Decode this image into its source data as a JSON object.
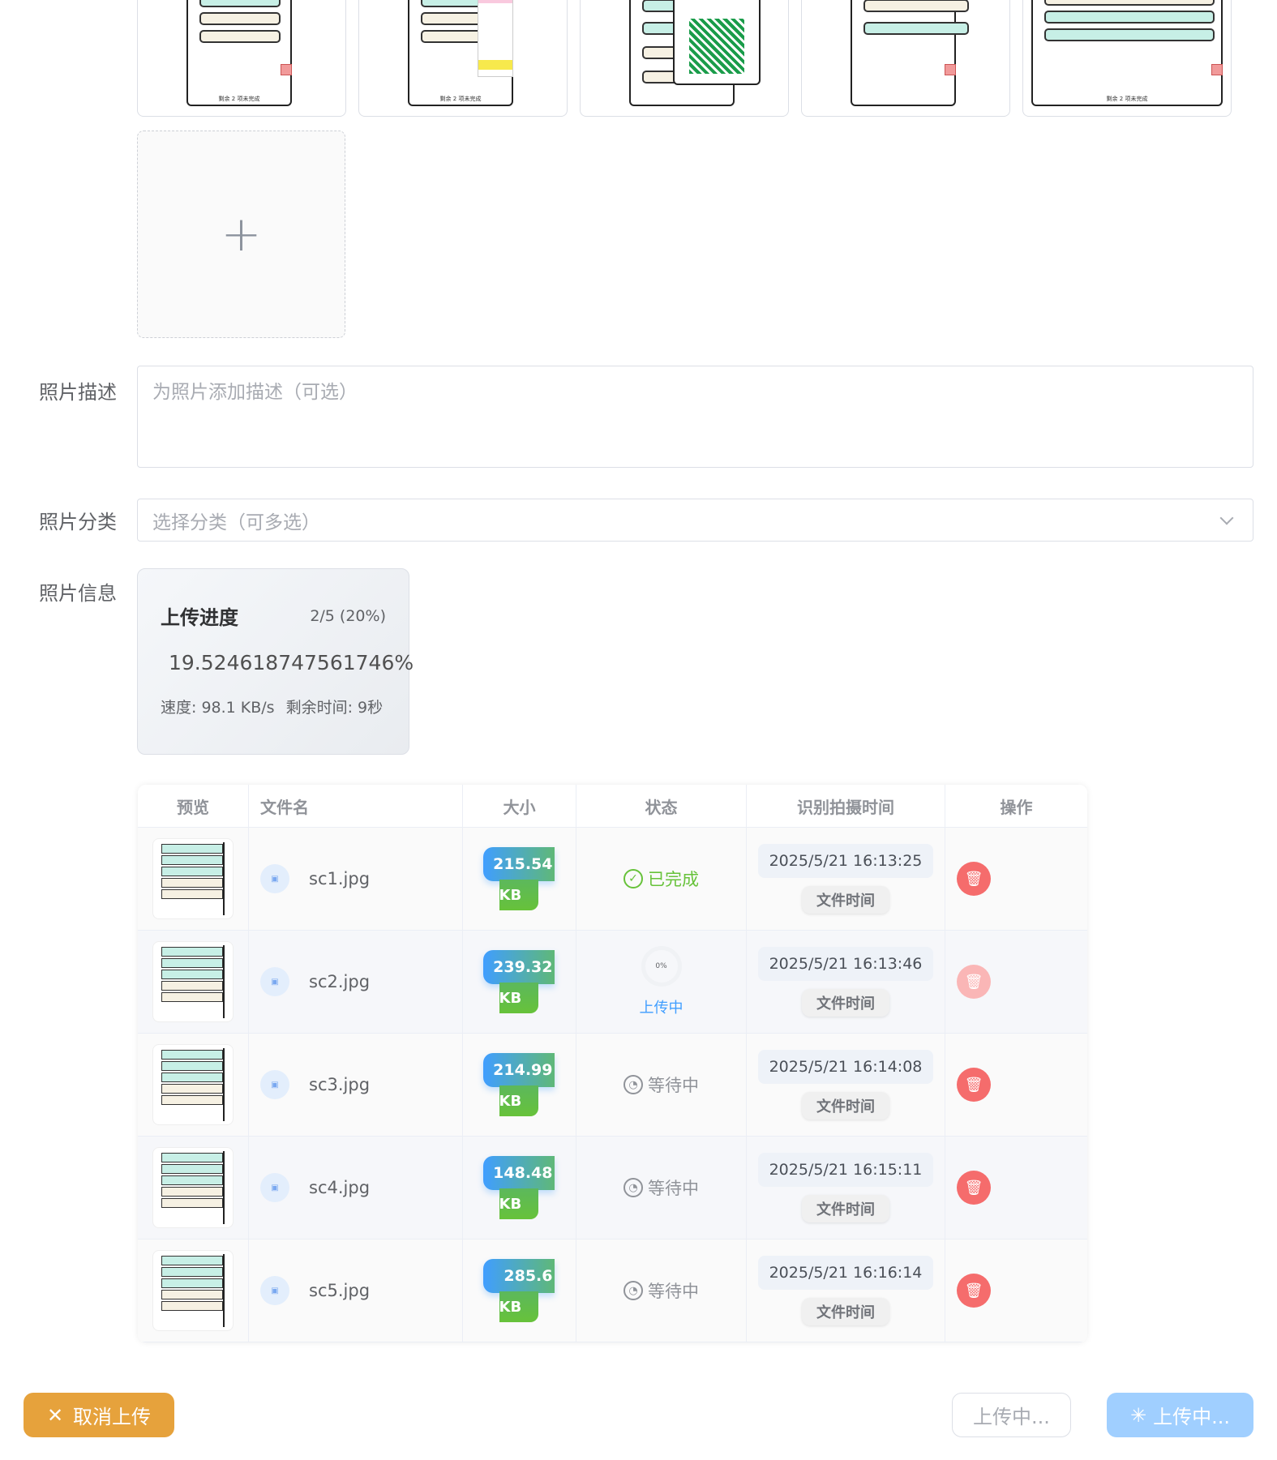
{
  "thumbnails": [
    {
      "caption": "剩余 2 项未完成"
    },
    {
      "caption": "剩余 2 项未完成"
    },
    {
      "caption": ""
    },
    {
      "caption": ""
    },
    {
      "caption": "剩余 2 项未完成"
    }
  ],
  "upload": {
    "add_icon": "+"
  },
  "form": {
    "description_label": "照片描述",
    "description_placeholder": "为照片添加描述（可选）",
    "category_label": "照片分类",
    "category_placeholder": "选择分类（可多选）",
    "info_label": "照片信息"
  },
  "progress": {
    "title": "上传进度",
    "count": "2/5 (20%)",
    "percent_text": "19.524618747561746%",
    "speed": "速度: 98.1 KB/s",
    "remaining": "剩余时间: 9秒",
    "percent": 19.52
  },
  "table": {
    "headers": [
      "预览",
      "文件名",
      "大小",
      "状态",
      "识别拍摄时间",
      "操作"
    ],
    "rows": [
      {
        "name": "sc1.jpg",
        "size": "215.54",
        "unit": "KB",
        "status": "已完成",
        "status_type": "done",
        "date": "2025/5/21 16:13:25",
        "tag": "文件时间"
      },
      {
        "name": "sc2.jpg",
        "size": "239.32",
        "unit": "KB",
        "status": "上传中",
        "status_type": "uploading",
        "progress": "0%",
        "date": "2025/5/21 16:13:46",
        "tag": "文件时间"
      },
      {
        "name": "sc3.jpg",
        "size": "214.99",
        "unit": "KB",
        "status": "等待中",
        "status_type": "waiting",
        "date": "2025/5/21 16:14:08",
        "tag": "文件时间"
      },
      {
        "name": "sc4.jpg",
        "size": "148.48",
        "unit": "KB",
        "status": "等待中",
        "status_type": "waiting",
        "date": "2025/5/21 16:15:11",
        "tag": "文件时间"
      },
      {
        "name": "sc5.jpg",
        "size": "285.6",
        "unit": "KB",
        "status": "等待中",
        "status_type": "waiting",
        "date": "2025/5/21 16:16:14",
        "tag": "文件时间"
      }
    ]
  },
  "buttons": {
    "cancel": "取消上传",
    "uploading_secondary": "上传中...",
    "uploading_primary": "上传中..."
  },
  "colors": {
    "success": "#67c23a",
    "primary": "#409eff",
    "danger": "#f56c6c",
    "warning": "#e6a23c"
  }
}
